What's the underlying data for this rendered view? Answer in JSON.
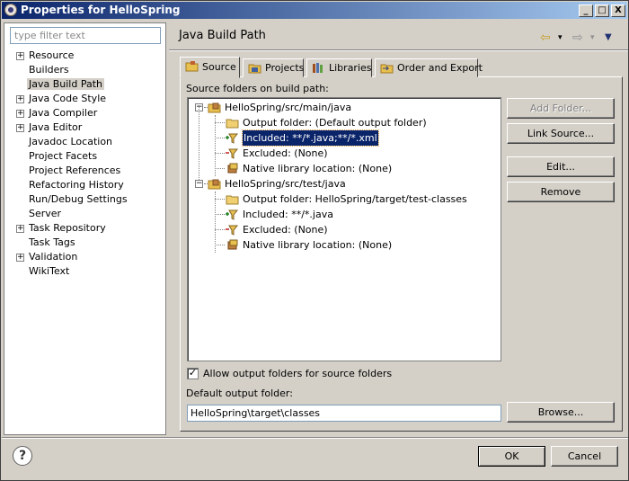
{
  "window": {
    "title": "Properties for HelloSpring",
    "minimize_glyph": "_",
    "maximize_glyph": "□",
    "close_glyph": "X"
  },
  "filter": {
    "placeholder": "type filter text"
  },
  "nav": [
    {
      "label": "Resource",
      "expandable": true
    },
    {
      "label": "Builders",
      "expandable": false
    },
    {
      "label": "Java Build Path",
      "expandable": false,
      "selected": true
    },
    {
      "label": "Java Code Style",
      "expandable": true
    },
    {
      "label": "Java Compiler",
      "expandable": true
    },
    {
      "label": "Java Editor",
      "expandable": true
    },
    {
      "label": "Javadoc Location",
      "expandable": false
    },
    {
      "label": "Project Facets",
      "expandable": false
    },
    {
      "label": "Project References",
      "expandable": false
    },
    {
      "label": "Refactoring History",
      "expandable": false
    },
    {
      "label": "Run/Debug Settings",
      "expandable": false
    },
    {
      "label": "Server",
      "expandable": false
    },
    {
      "label": "Task Repository",
      "expandable": true
    },
    {
      "label": "Task Tags",
      "expandable": false
    },
    {
      "label": "Validation",
      "expandable": true
    },
    {
      "label": "WikiText",
      "expandable": false
    }
  ],
  "page_title": "Java Build Path",
  "tabs": [
    {
      "label": "Source",
      "active": true,
      "icon": "source-folder-icon"
    },
    {
      "label": "Projects",
      "active": false,
      "icon": "projects-icon"
    },
    {
      "label": "Libraries",
      "active": false,
      "icon": "libraries-icon"
    },
    {
      "label": "Order and Export",
      "active": false,
      "icon": "order-export-icon"
    }
  ],
  "source_label": "Source folders on build path:",
  "tree": [
    {
      "level": 0,
      "text": "HelloSpring/src/main/java",
      "icon": "package-folder-icon",
      "expanded": true
    },
    {
      "level": 1,
      "text": "Output folder: (Default output folder)",
      "icon": "folder-icon"
    },
    {
      "level": 1,
      "text": "Included: **/*.java;**/*.xml",
      "icon": "inclusion-filter-icon",
      "selected": true
    },
    {
      "level": 1,
      "text": "Excluded: (None)",
      "icon": "exclusion-filter-icon"
    },
    {
      "level": 1,
      "text": "Native library location: (None)",
      "icon": "native-library-icon"
    },
    {
      "level": 0,
      "text": "HelloSpring/src/test/java",
      "icon": "package-folder-icon",
      "expanded": true
    },
    {
      "level": 1,
      "text": "Output folder: HelloSpring/target/test-classes",
      "icon": "folder-icon"
    },
    {
      "level": 1,
      "text": "Included: **/*.java",
      "icon": "inclusion-filter-icon"
    },
    {
      "level": 1,
      "text": "Excluded: (None)",
      "icon": "exclusion-filter-icon"
    },
    {
      "level": 1,
      "text": "Native library location: (None)",
      "icon": "native-library-icon"
    }
  ],
  "buttons": {
    "add_folder": "Add Folder...",
    "link_source": "Link Source...",
    "edit": "Edit...",
    "remove": "Remove",
    "browse": "Browse...",
    "ok": "OK",
    "cancel": "Cancel"
  },
  "allow_output_checkbox": {
    "label": "Allow output folders for source folders",
    "checked": true
  },
  "default_output": {
    "label": "Default output folder:",
    "value": "HelloSpring\\target\\classes"
  },
  "help": {
    "glyph": "?"
  },
  "nav_arrows": {
    "back": "⇦",
    "forward": "⇨",
    "menu": "▾",
    "dropdown": "▼"
  }
}
